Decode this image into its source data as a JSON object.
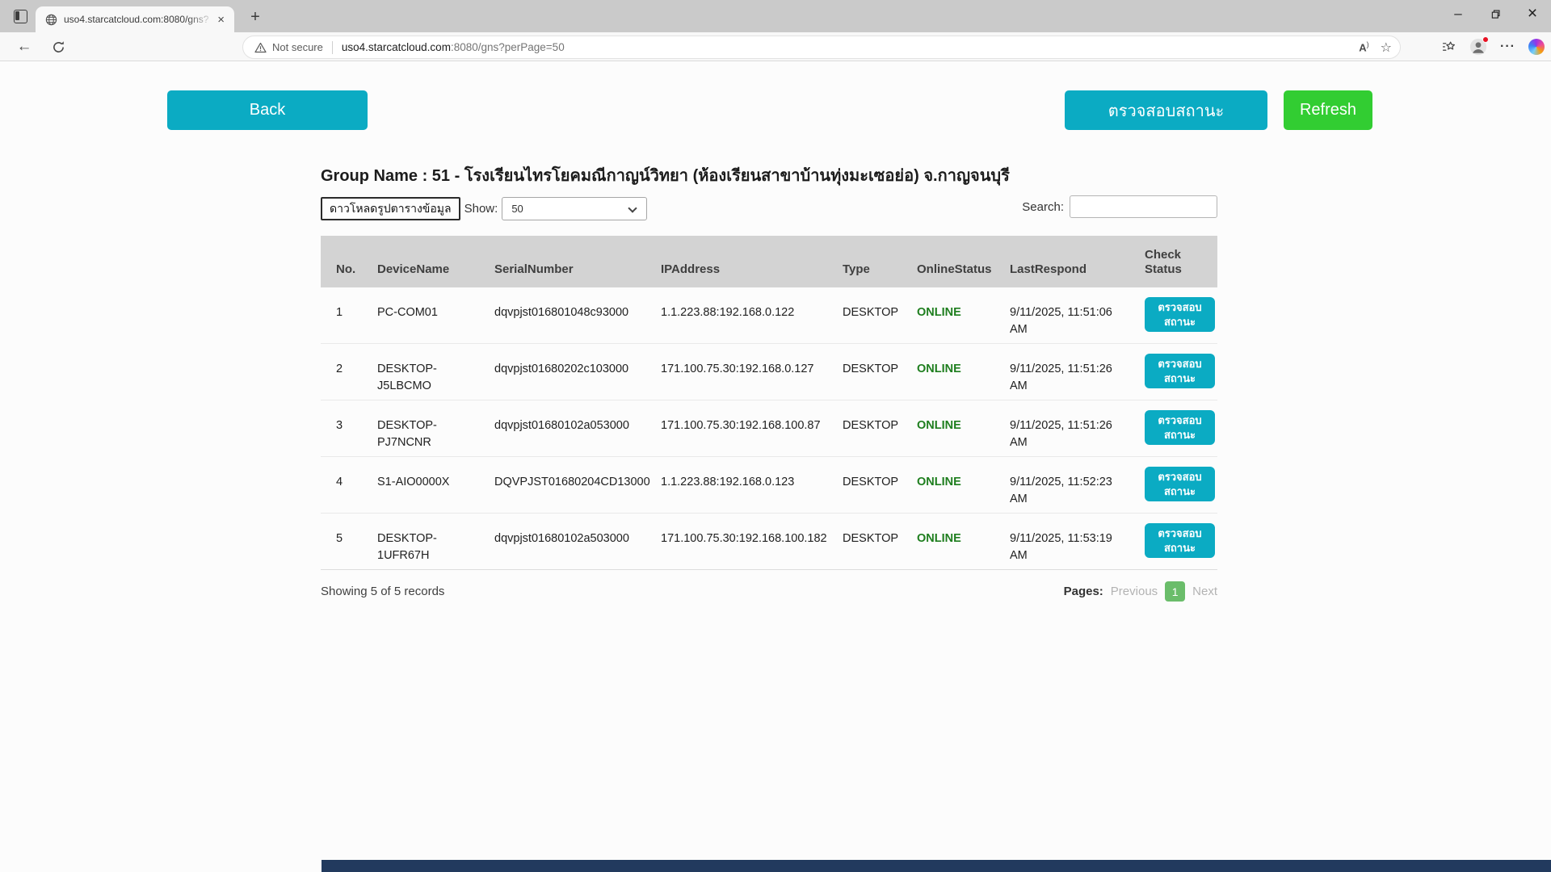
{
  "browser": {
    "tab": {
      "title": "uso4.starcatcloud.com:8080/gns?",
      "close_glyph": "×"
    },
    "new_tab_glyph": "+",
    "window_controls": {
      "minimize_glyph": "–",
      "close_glyph": "×"
    },
    "address_bar": {
      "security_label": "Not secure",
      "url_host": "uso4.starcatcloud.com",
      "url_path": ":8080/gns?perPage=50"
    }
  },
  "actions": {
    "back_label": "Back",
    "check_status_label": "ตรวจสอบสถานะ",
    "refresh_label": "Refresh"
  },
  "page": {
    "group_title": "Group Name : 51 - โรงเรียนไทรโยคมณีกาญน์วิทยา (ห้องเรียนสาขาบ้านทุ่งมะเซอย่อ) จ.กาญจนบุรี",
    "download_button_label": "ดาวโหลดรูปตารางข้อมูล",
    "show_label": "Show:",
    "show_value": "50",
    "search_label": "Search:",
    "search_value": ""
  },
  "table": {
    "columns": [
      "No.",
      "DeviceName",
      "SerialNumber",
      "IPAddress",
      "Type",
      "OnlineStatus",
      "LastRespond",
      "Check Status"
    ],
    "check_button_label": "ตรวจสอบสถานะ",
    "rows": [
      {
        "no": "1",
        "device": "PC-COM01",
        "serial": "dqvpjst016801048c93000",
        "ip": "1.1.223.88:192.168.0.122",
        "type": "DESKTOP",
        "status": "ONLINE",
        "last": "9/11/2025, 11:51:06 AM"
      },
      {
        "no": "2",
        "device": "DESKTOP-J5LBCMO",
        "serial": "dqvpjst01680202c103000",
        "ip": "171.100.75.30:192.168.0.127",
        "type": "DESKTOP",
        "status": "ONLINE",
        "last": "9/11/2025, 11:51:26 AM"
      },
      {
        "no": "3",
        "device": "DESKTOP-PJ7NCNR",
        "serial": "dqvpjst01680102a053000",
        "ip": "171.100.75.30:192.168.100.87",
        "type": "DESKTOP",
        "status": "ONLINE",
        "last": "9/11/2025, 11:51:26 AM"
      },
      {
        "no": "4",
        "device": "S1-AIO0000X",
        "serial": "DQVPJST01680204CD13000",
        "ip": "1.1.223.88:192.168.0.123",
        "type": "DESKTOP",
        "status": "ONLINE",
        "last": "9/11/2025, 11:52:23 AM"
      },
      {
        "no": "5",
        "device": "DESKTOP-1UFR67H",
        "serial": "dqvpjst01680102a503000",
        "ip": "171.100.75.30:192.168.100.182",
        "type": "DESKTOP",
        "status": "ONLINE",
        "last": "9/11/2025, 11:53:19 AM"
      }
    ]
  },
  "footer": {
    "showing": "Showing 5 of 5 records",
    "pages_label": "Pages:",
    "previous_label": "Previous",
    "current_page": "1",
    "next_label": "Next"
  },
  "colors": {
    "teal": "#0babc3",
    "refresh_green": "#32cd32",
    "online_green": "#1e7e1e",
    "page_badge_green": "#6abd6a",
    "table_header_gray": "#d3d3d3"
  }
}
